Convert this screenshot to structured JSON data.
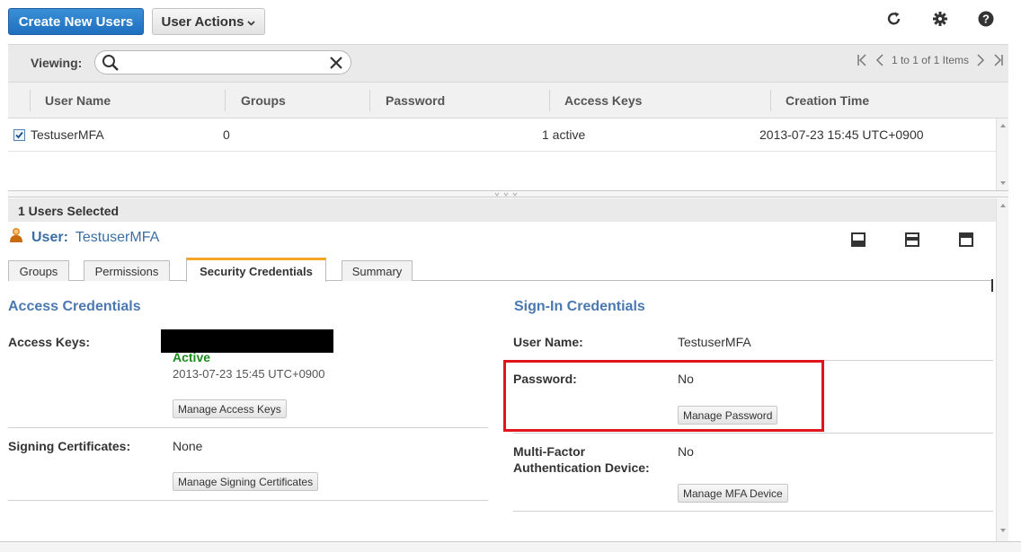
{
  "toolbar": {
    "create_button": "Create New Users",
    "actions_button": "User Actions",
    "icons": [
      "refresh-icon",
      "gear-icon",
      "help-icon"
    ]
  },
  "filter": {
    "viewing_label": "Viewing:",
    "search_value": "",
    "search_placeholder": "",
    "pager_text": "1 to 1 of 1 Items"
  },
  "table": {
    "columns": [
      "User Name",
      "Groups",
      "Password",
      "Access Keys",
      "Creation Time"
    ],
    "rows": [
      {
        "checked": true,
        "user_name": "TestuserMFA",
        "groups": "0",
        "password": "",
        "access_keys": "1 active",
        "creation_time": "2013-07-23 15:45 UTC+0900"
      }
    ]
  },
  "details": {
    "selected_text": "1 Users Selected",
    "user_label": "User:",
    "user_value": "TestuserMFA",
    "tabs": [
      {
        "label": "Groups",
        "active": false
      },
      {
        "label": "Permissions",
        "active": false
      },
      {
        "label": "Security Credentials",
        "active": true
      },
      {
        "label": "Summary",
        "active": false
      }
    ],
    "access": {
      "title": "Access Credentials",
      "access_keys_label": "Access Keys:",
      "access_key_status": "Active",
      "access_key_date": "2013-07-23 15:45 UTC+0900",
      "manage_access_keys": "Manage Access Keys",
      "signing_label": "Signing Certificates:",
      "signing_value": "None",
      "manage_signing": "Manage Signing Certificates"
    },
    "signin": {
      "title": "Sign-In Credentials",
      "user_name_label": "User Name:",
      "user_name_value": "TestuserMFA",
      "password_label": "Password:",
      "password_value": "No",
      "manage_password": "Manage Password",
      "mfa_label_line1": "Multi-Factor",
      "mfa_label_line2": "Authentication Device:",
      "mfa_value": "No",
      "manage_mfa": "Manage MFA Device"
    }
  },
  "colors": {
    "primary": "#1f6fbf",
    "section_title": "#4a78b0",
    "active_status": "#1a8c1a",
    "highlight": "#e0161d",
    "tab_accent": "#f5a623"
  }
}
